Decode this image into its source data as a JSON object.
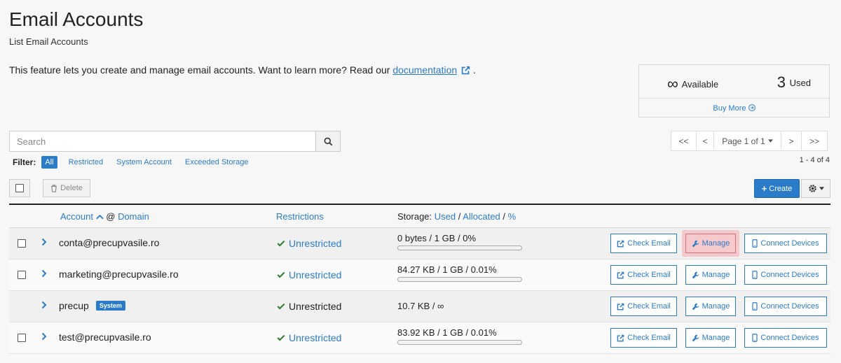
{
  "header": {
    "title": "Email Accounts",
    "subtitle": "List Email Accounts",
    "intro_text": "This feature lets you create and manage email accounts. Want to learn more? Read our ",
    "intro_link": "documentation",
    "intro_end": "."
  },
  "stats": {
    "available_value": "∞",
    "available_label": "Available",
    "used_value": "3",
    "used_label": "Used",
    "buy_more": "Buy More"
  },
  "search": {
    "placeholder": "Search"
  },
  "filter": {
    "label": "Filter:",
    "options": [
      "All",
      "Restricted",
      "System Account",
      "Exceeded Storage"
    ],
    "selected": "All"
  },
  "pager": {
    "first": "<<",
    "prev": "<",
    "page": "Page 1 of 1",
    "next": ">",
    "last": ">>",
    "count": "1 - 4 of 4"
  },
  "toolbar": {
    "delete_label": "Delete",
    "create_label": "Create"
  },
  "table": {
    "col_account": "Account",
    "col_at": "@",
    "col_domain": "Domain",
    "col_restrictions": "Restrictions",
    "col_storage_prefix": "Storage:",
    "col_storage_used": "Used",
    "col_storage_sep1": "/",
    "col_storage_allocated": "Allocated",
    "col_storage_sep2": "/",
    "col_storage_pct": "%",
    "rows": [
      {
        "account": "conta@precupvasile.ro",
        "badge": "",
        "restriction": "Unrestricted",
        "storage": "0 bytes / 1 GB / 0%",
        "usage_fraction": 0,
        "check_email": "Check Email",
        "manage": "Manage",
        "connect": "Connect Devices"
      },
      {
        "account": "marketing@precupvasile.ro",
        "badge": "",
        "restriction": "Unrestricted",
        "storage": "84.27 KB / 1 GB / 0.01%",
        "usage_fraction": 0.0001,
        "check_email": "Check Email",
        "manage": "Manage",
        "connect": "Connect Devices"
      },
      {
        "account": "precup",
        "badge": "System",
        "restriction": "Unrestricted",
        "storage": "10.7 KB / ∞",
        "usage_fraction": null,
        "check_email": "Check Email",
        "manage": "Manage",
        "connect": "Connect Devices"
      },
      {
        "account": "test@precupvasile.ro",
        "badge": "",
        "restriction": "Unrestricted",
        "storage": "83.92 KB / 1 GB / 0.01%",
        "usage_fraction": 0.0001,
        "check_email": "Check Email",
        "manage": "Manage",
        "connect": "Connect Devices"
      }
    ]
  },
  "colors": {
    "accent": "#2a7bc8",
    "success": "#2e7d32",
    "highlight": "#f6c9cc"
  }
}
